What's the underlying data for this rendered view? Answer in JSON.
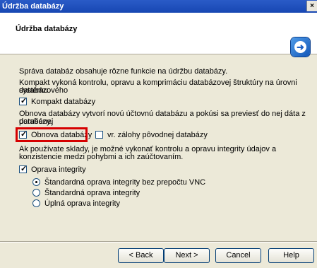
{
  "window": {
    "title": "Údržba databázy",
    "close_glyph": "×"
  },
  "header": {
    "title": "Údržba databázy",
    "logo_glyph": "➜"
  },
  "body": {
    "intro": "Správa databáz obsahuje rôzne funkcie na údržbu databázy.",
    "compact_desc_line1": "Kompakt vykoná kontrolu, opravu a komprimáciu databázovej štruktúry na úrovni databázového",
    "compact_desc_line2": "systému.",
    "compact_label": "Kompakt databázy",
    "restore_desc_line1": "Obnova databázy vytvorí novú účtovnú databázu a pokúsi sa previesť do nej dáta z porušenej",
    "restore_desc_line2": "databázy.",
    "restore_label": "Obnova databázy",
    "backups_label": "vr. zálohy pôvodnej databázy",
    "integrity_desc_line1": "Ak používate sklady, je možné vykonať kontrolu a opravu integrity údajov a",
    "integrity_desc_line2": "konzistencie medzi pohybmi a ich zaúčtovaním.",
    "integrity_label": "Oprava integrity",
    "radio_options": [
      "Štandardná oprava integrity bez prepočtu VNC",
      "Štandardná oprava integrity",
      "Úplná oprava integrity"
    ]
  },
  "buttons": {
    "back": "< Back",
    "next": "Next >",
    "cancel": "Cancel",
    "help": "Help"
  }
}
